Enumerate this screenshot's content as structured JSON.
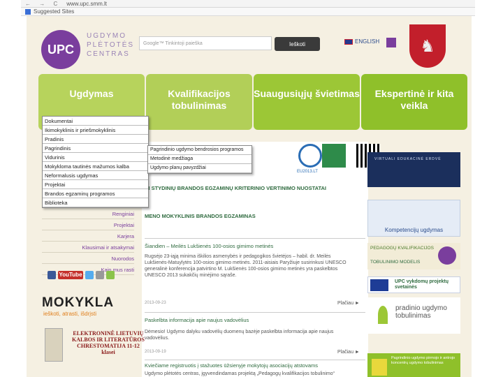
{
  "browser": {
    "nav_icons": "← → C",
    "url": "www.upc.smm.lt",
    "bookmark_label": "Suggested Sites"
  },
  "header": {
    "logo_mark": "UPC",
    "logo_text": "UGDYMO PLĖTOTĖS CENTRAS",
    "search_placeholder": "Google™ Tinkintoji paieška",
    "search_button": "Ieškoti",
    "language": "ENGLISH",
    "crest_glyph": "♞"
  },
  "tabs": [
    {
      "label": "Ugdymas"
    },
    {
      "label": "Kvalifikacijos tobulinimas"
    },
    {
      "label": "Suaugusiųjų švietimas"
    },
    {
      "label": "Ekspertinė ir kita veikla"
    }
  ],
  "dropdown": [
    "Dokumentai",
    "Ikimokyklinis ir priešmokyklinis",
    "Pradinis",
    "Pagrindinis",
    "Vidurinis",
    "Mokykloma tautinės mažumos kalba",
    "Neformalusis ugdymas",
    "Projektai",
    "Brandos egzaminų programos",
    "Biblioteka"
  ],
  "submenu": [
    "Pagrindinio ugdymo bendrosios programos",
    "Metodinė medžiaga",
    "Ugdymo planų pavyzdžiai"
  ],
  "sidelinks": [
    "Renginiai",
    "Projektai",
    "Karjera",
    "Klausimai ir atsakymai",
    "Nuorodos",
    "Kaip mus rasti"
  ],
  "social": {
    "youtube": "YouTube"
  },
  "mokykla": {
    "title": "MOKYKLA",
    "subtitle": "ieškoti, atrasti, išdrįsti"
  },
  "book": {
    "text": "ELEKTRONINĖ LIETUVIŲ KALBOS IR LITERATŪROS CHRESTOMATIJA 11-12 klasei"
  },
  "center": {
    "eu_label": "EU2013.LT",
    "headline1": "AI STYDINIŲ BRANDOS EGZAMINŲ KRITERINIO VERTINIMO NUOSTATAI",
    "headline2": "MENO MOKYKLINIS BRANDOS EGZAMINAS",
    "news": [
      {
        "title": "Šiandien – Meilės Lukšienės 100-osios gimimo metinės",
        "body": "Rugsėjo 23-iąją minima iškilios asmenybės ir pedagogikos švietėjos – habil. dr. Meilės Lukšienės-Matuylytės 100-osios gimimo metinės. 2011-aisiais Paryžiuje susirinkusi UNESCO generalinė konferencija patvirtino M. Lukšienės 100-osios gimimo metinės yra paskelbtos UNESCO 2013 sukakčių minėjimo sąraše.",
        "date": "2013-09-23",
        "more": "Plačiau ►"
      },
      {
        "title": "Paskelbta informacija apie naujus vadovėlius",
        "body": "Dėmesio! Ugdymo dalyku vadovėlių duomenų bazėje paskelbta informacija apie naujus vadovėlius.",
        "date": "2013-09-19",
        "more": "Plačiau ►"
      },
      {
        "title": "Kviečiame registruotis į stažuotes ūžsienyje mokytojų asociacijų atstovams",
        "body": "Ugdymo plėtotės centras, įgyvendindamas projektą „Pedagogų kvalifikacijos tobulinimo“",
        "date": "",
        "more": ""
      }
    ]
  },
  "right": {
    "banner1": "VIRTUALI EDUKACINĖ ERDVĖ",
    "banner2": "Kompetencijų ugdymas",
    "banner3_line1": "PEDAGOGŲ KVALIFIKACIJOS",
    "banner3_line2": "TOBULINIMO MODELIS",
    "banner4": "UPC vykdomų projektų svetainės",
    "banner5": "pradinio ugdymo tobulinimas",
    "banner6": "Pagrindinio ugdymo pirmojo ir antrojo koncentrų ugdymo tobulinimas"
  },
  "colors": {
    "purple": "#7a3e9d",
    "green": "#2f6b3f",
    "tab_green": "#9cc736",
    "background": "#f5f0e2"
  }
}
